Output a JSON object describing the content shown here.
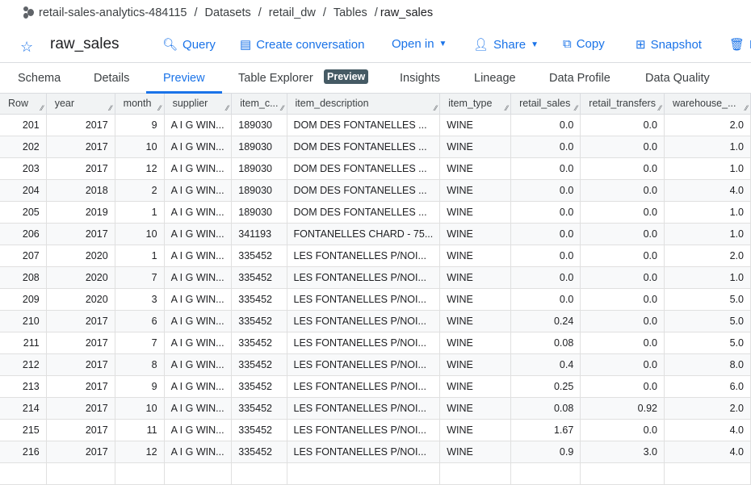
{
  "breadcrumb": {
    "project": "retail-sales-analytics-484115",
    "datasets": "Datasets",
    "dataset": "retail_dw",
    "tables": "Tables",
    "table": "raw_sales"
  },
  "header": {
    "title": "raw_sales",
    "query": "Query",
    "create_conversation": "Create conversation",
    "open_in": "Open in",
    "share": "Share",
    "copy": "Copy",
    "snapshot": "Snapshot",
    "delete": "D"
  },
  "tabs": [
    "Schema",
    "Details",
    "Preview",
    "Table Explorer",
    "Insights",
    "Lineage",
    "Data Profile",
    "Data Quality"
  ],
  "tab_badge": "Preview",
  "active_tab": "Preview",
  "columns": [
    "Row",
    "year",
    "month",
    "supplier",
    "item_c...",
    "item_description",
    "item_type",
    "retail_sales",
    "retail_transfers",
    "warehouse_..."
  ],
  "rows": [
    [
      "201",
      "2017",
      "9",
      "A I G WIN...",
      "189030",
      "DOM DES FONTANELLES ...",
      "WINE",
      "0.0",
      "0.0",
      "2.0"
    ],
    [
      "202",
      "2017",
      "10",
      "A I G WIN...",
      "189030",
      "DOM DES FONTANELLES ...",
      "WINE",
      "0.0",
      "0.0",
      "1.0"
    ],
    [
      "203",
      "2017",
      "12",
      "A I G WIN...",
      "189030",
      "DOM DES FONTANELLES ...",
      "WINE",
      "0.0",
      "0.0",
      "1.0"
    ],
    [
      "204",
      "2018",
      "2",
      "A I G WIN...",
      "189030",
      "DOM DES FONTANELLES ...",
      "WINE",
      "0.0",
      "0.0",
      "4.0"
    ],
    [
      "205",
      "2019",
      "1",
      "A I G WIN...",
      "189030",
      "DOM DES FONTANELLES ...",
      "WINE",
      "0.0",
      "0.0",
      "1.0"
    ],
    [
      "206",
      "2017",
      "10",
      "A I G WIN...",
      "341193",
      "FONTANELLES CHARD - 75...",
      "WINE",
      "0.0",
      "0.0",
      "1.0"
    ],
    [
      "207",
      "2020",
      "1",
      "A I G WIN...",
      "335452",
      "LES FONTANELLES P/NOI...",
      "WINE",
      "0.0",
      "0.0",
      "2.0"
    ],
    [
      "208",
      "2020",
      "7",
      "A I G WIN...",
      "335452",
      "LES FONTANELLES P/NOI...",
      "WINE",
      "0.0",
      "0.0",
      "1.0"
    ],
    [
      "209",
      "2020",
      "3",
      "A I G WIN...",
      "335452",
      "LES FONTANELLES P/NOI...",
      "WINE",
      "0.0",
      "0.0",
      "5.0"
    ],
    [
      "210",
      "2017",
      "6",
      "A I G WIN...",
      "335452",
      "LES FONTANELLES P/NOI...",
      "WINE",
      "0.24",
      "0.0",
      "5.0"
    ],
    [
      "211",
      "2017",
      "7",
      "A I G WIN...",
      "335452",
      "LES FONTANELLES P/NOI...",
      "WINE",
      "0.08",
      "0.0",
      "5.0"
    ],
    [
      "212",
      "2017",
      "8",
      "A I G WIN...",
      "335452",
      "LES FONTANELLES P/NOI...",
      "WINE",
      "0.4",
      "0.0",
      "8.0"
    ],
    [
      "213",
      "2017",
      "9",
      "A I G WIN...",
      "335452",
      "LES FONTANELLES P/NOI...",
      "WINE",
      "0.25",
      "0.0",
      "6.0"
    ],
    [
      "214",
      "2017",
      "10",
      "A I G WIN...",
      "335452",
      "LES FONTANELLES P/NOI...",
      "WINE",
      "0.08",
      "0.92",
      "2.0"
    ],
    [
      "215",
      "2017",
      "11",
      "A I G WIN...",
      "335452",
      "LES FONTANELLES P/NOI...",
      "WINE",
      "1.67",
      "0.0",
      "4.0"
    ],
    [
      "216",
      "2017",
      "12",
      "A I G WIN...",
      "335452",
      "LES FONTANELLES P/NOI...",
      "WINE",
      "0.9",
      "3.0",
      "4.0"
    ],
    [
      "",
      "",
      "",
      "",
      "",
      "",
      "",
      "",
      "",
      ""
    ]
  ]
}
